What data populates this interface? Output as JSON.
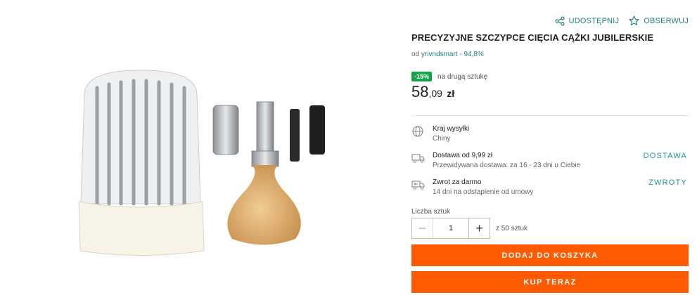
{
  "actions": {
    "share": "UDOSTĘPNIJ",
    "watch": "OBSERWUJ"
  },
  "product": {
    "title": "PRECYZYJNE SZCZYPCE CIĘCIA CĄŻKI JUBILERSKIE",
    "seller_prefix": "od",
    "seller_name": "yrivndsmart - 94,8%"
  },
  "promo": {
    "badge": "-15%",
    "text": "na drugą sztukę"
  },
  "price": {
    "integer": "58",
    "fraction": ",09",
    "currency": "zł"
  },
  "shipping_country": {
    "title": "Kraj wysyłki",
    "value": "Chiny"
  },
  "delivery": {
    "title": "Dostawa od 9,99 zł",
    "detail": "Przewidywana dostawa: za 16 - 23 dni u Ciebie",
    "link": "DOSTAWA"
  },
  "returns": {
    "title": "Zwrot za darmo",
    "detail": "14 dni na odstąpienie od umowy",
    "link": "ZWROTY"
  },
  "quantity": {
    "label": "Liczba sztuk",
    "value": "1",
    "minus": "−",
    "plus": "+",
    "of": "z 50 sztuk"
  },
  "buttons": {
    "add_to_cart": "DODAJ DO KOSZYKA",
    "buy_now": "KUP TERAZ"
  },
  "colors": {
    "accent": "#1f7f7a",
    "cta": "#ff5a00",
    "badge": "#16a34a"
  }
}
